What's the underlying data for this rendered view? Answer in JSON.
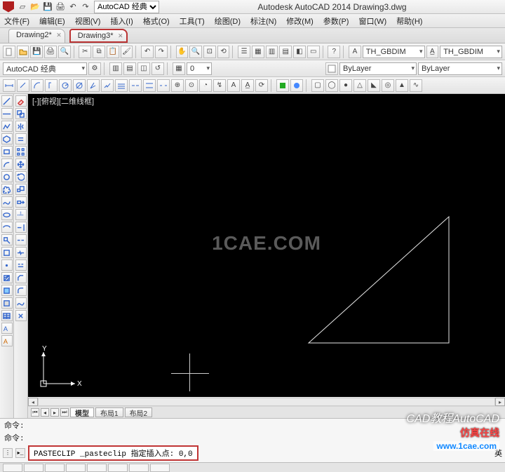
{
  "titlebar": {
    "workspace_label": "AutoCAD 经典",
    "app_title": "Autodesk AutoCAD 2014  Drawing3.dwg"
  },
  "menubar": {
    "items": [
      "文件(F)",
      "编辑(E)",
      "视图(V)",
      "插入(I)",
      "格式(O)",
      "工具(T)",
      "绘图(D)",
      "标注(N)",
      "修改(M)",
      "参数(P)",
      "窗口(W)",
      "帮助(H)"
    ]
  },
  "doc_tabs": [
    {
      "label": "Drawing2*"
    },
    {
      "label": "Drawing3*",
      "active": true
    }
  ],
  "combos": {
    "workspace": "AutoCAD 经典",
    "dimstyle1": "TH_GBDIM",
    "dimstyle2": "TH_GBDIM",
    "layer": "ByLayer",
    "linetype": "ByLayer",
    "layer_zero": "0"
  },
  "viewport": {
    "label": "[-][俯视][二维线框]",
    "ucs_x": "X",
    "ucs_y": "Y",
    "watermark": "1CAE.COM"
  },
  "model_tabs": {
    "items": [
      "模型",
      "布局1",
      "布局2"
    ]
  },
  "cmd": {
    "history1": "命令:",
    "history2": "命令:",
    "prompt": "PASTECLIP _pasteclip 指定插入点: 0,0"
  },
  "status_lang": "英",
  "overlay": {
    "brand": "CAD教程AutoCAD",
    "brand_cn": "仿真在线",
    "url": "www.1cae.com"
  }
}
